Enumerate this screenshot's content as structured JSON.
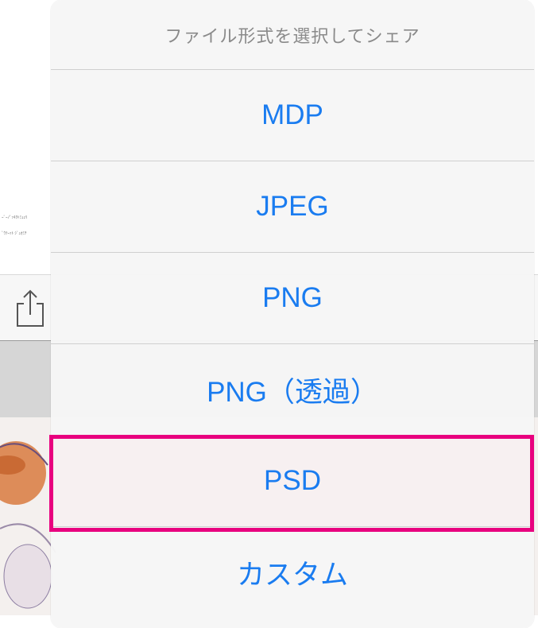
{
  "background": {
    "page_text_lines": [
      "ｰﾞｰﾉﾞｯｷｸﾄﾐｭｪﾘ",
      "ﾞｳﾃｰｯﾄ ｼﾞｭｵﾐﾁ"
    ],
    "share_icon": "share-icon"
  },
  "sheet": {
    "title": "ファイル形式を選択してシェア",
    "options": [
      {
        "label": "MDP"
      },
      {
        "label": "JPEG"
      },
      {
        "label": "PNG"
      },
      {
        "label": "PNG（透過）"
      },
      {
        "label": "PSD"
      },
      {
        "label": "カスタム"
      }
    ],
    "highlighted_option": "PSD",
    "colors": {
      "accent": "#1a7cf0",
      "highlight_frame": "#e8007f",
      "title": "#8a8a8a"
    }
  }
}
